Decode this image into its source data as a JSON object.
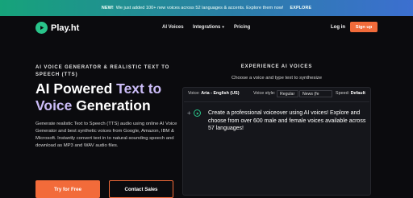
{
  "banner": {
    "new_label": "NEW!",
    "message": "We just added 100+ new voices across 52 languages & accents. Explore them now!",
    "explore_label": "EXPLORE"
  },
  "nav": {
    "logo_text": "Play.ht",
    "menu": [
      {
        "label": "AI Voices",
        "has_dropdown": false
      },
      {
        "label": "Integrations",
        "has_dropdown": true
      },
      {
        "label": "Pricing",
        "has_dropdown": false
      }
    ],
    "login_label": "Log in",
    "signup_label": "Sign up"
  },
  "hero": {
    "eyebrow": "AI VOICE GENERATOR & REALISTIC TEXT TO SPEECH (TTS)",
    "title_part1": "AI Powered ",
    "title_highlight": "Text to",
    "title_part2a": "Voice",
    "title_part2b": " Generation",
    "description": "Generate realistic Text to Speech (TTS) audio using online AI Voice Generator and best synthetic voices from Google, Amazon, IBM & Microsoft. Instantly convert text in to natural-sounding speech and download as MP3 and WAV audio files.",
    "try_label": "Try for Free",
    "contact_label": "Contact Sales"
  },
  "experience": {
    "title": "EXPERIENCE AI VOICES",
    "subtitle": "Choose a voice and type text to synthesize",
    "voice_label": "Voice:",
    "voice_value": "Aria - English (US)",
    "style_label": "Voice style:",
    "style_value": "Regular",
    "style_option": "News (fe",
    "speed_label": "Speed:",
    "speed_value": "Default",
    "plus_symbol": "+",
    "text": "Create a professional voiceover using AI voices! Explore and choose from over 600 male and female voices available across 57 languages!"
  },
  "colors": {
    "accent": "#f26b3a",
    "brand_green": "#29c48a",
    "highlight": "#cbbcf7",
    "background": "#0b0b0e"
  }
}
